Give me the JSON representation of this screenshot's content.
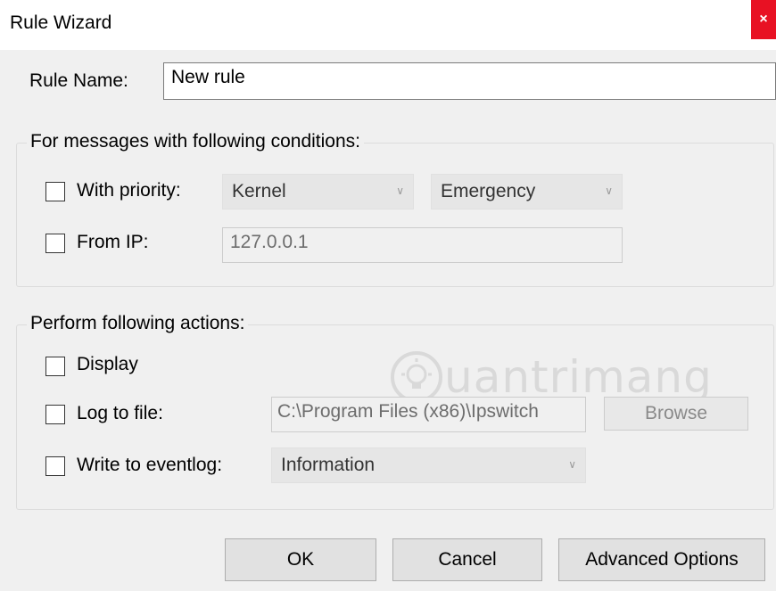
{
  "window": {
    "title": "Rule Wizard",
    "close_glyph": "×"
  },
  "rule_name": {
    "label": "Rule Name:",
    "value": "New rule"
  },
  "conditions": {
    "title": "For messages with following conditions:",
    "priority": {
      "label": "With priority:",
      "checked": false,
      "facility": "Kernel",
      "level": "Emergency"
    },
    "from_ip": {
      "label": "From IP:",
      "checked": false,
      "value": "127.0.0.1"
    }
  },
  "actions": {
    "title": "Perform following actions:",
    "display": {
      "label": "Display",
      "checked": false
    },
    "log_to_file": {
      "label": "Log to file:",
      "checked": false,
      "path": "C:\\Program Files (x86)\\Ipswitch",
      "browse_label": "Browse"
    },
    "eventlog": {
      "label": "Write to eventlog:",
      "checked": false,
      "level": "Information"
    }
  },
  "buttons": {
    "ok": "OK",
    "cancel": "Cancel",
    "advanced": "Advanced Options"
  },
  "watermark": {
    "text": "uantrimang",
    "icon": "lightbulb-icon"
  },
  "colors": {
    "close_button": "#e81123",
    "window_bg": "#f0f0f0"
  }
}
